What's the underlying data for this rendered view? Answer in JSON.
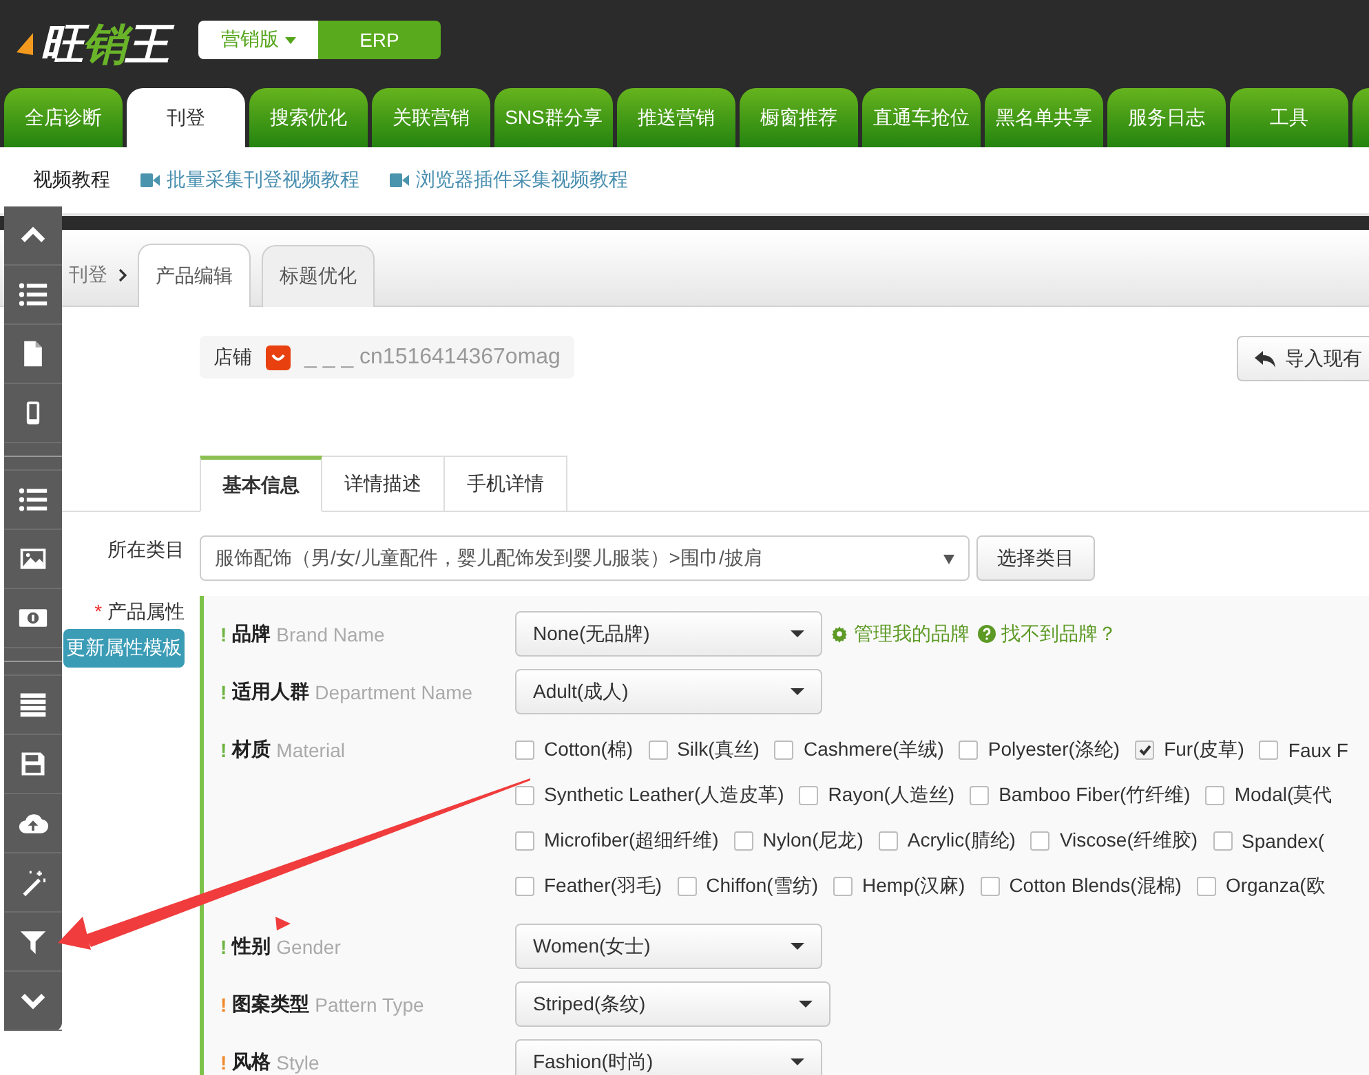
{
  "app": {
    "logo": "旺销王",
    "editions": [
      {
        "label": "营销版",
        "selected": true,
        "dropdown": true
      },
      {
        "label": "ERP",
        "selected": false,
        "dropdown": false
      }
    ]
  },
  "nav_tabs": [
    {
      "label": "全店诊断",
      "selected": false
    },
    {
      "label": "刊登",
      "selected": true
    },
    {
      "label": "搜索优化",
      "selected": false
    },
    {
      "label": "关联营销",
      "selected": false
    },
    {
      "label": "SNS群分享",
      "selected": false
    },
    {
      "label": "推送营销",
      "selected": false
    },
    {
      "label": "橱窗推荐",
      "selected": false
    },
    {
      "label": "直通车抢位",
      "selected": false
    },
    {
      "label": "黑名单共享",
      "selected": false
    },
    {
      "label": "服务日志",
      "selected": false
    },
    {
      "label": "工具",
      "selected": false
    }
  ],
  "tutorials": {
    "title": "视频教程",
    "links": [
      "批量采集刊登视频教程",
      "浏览器插件采集视频教程"
    ]
  },
  "breadcrumb": "刊登",
  "page_tabs": [
    {
      "label": "产品编辑",
      "selected": true
    },
    {
      "label": "标题优化",
      "selected": false
    }
  ],
  "store": {
    "label": "店铺",
    "name": "_ _ _ cn1516414367omag"
  },
  "import_button": "导入现有",
  "form_tabs": [
    {
      "label": "基本信息",
      "selected": true
    },
    {
      "label": "详情描述",
      "selected": false
    },
    {
      "label": "手机详情",
      "selected": false
    }
  ],
  "category": {
    "label": "所在类目",
    "value": "服饰配饰（男/女/儿童配件，婴儿配饰发到婴儿服装）>围巾/披肩",
    "button": "选择类目"
  },
  "attributes_label": {
    "mark": "*",
    "text": "产品属性"
  },
  "update_button": "更新属性模板",
  "attributes": [
    {
      "kind": "select",
      "flag": "!",
      "color": "#6db33f",
      "name": "品牌",
      "name_en": "Brand Name",
      "value": "None(无品牌)",
      "links": [
        "管理我的品牌",
        "找不到品牌？"
      ]
    },
    {
      "kind": "select",
      "flag": "!",
      "color": "#6db33f",
      "name": "适用人群",
      "name_en": "Department Name",
      "value": "Adult(成人)"
    },
    {
      "kind": "checkboxes",
      "flag": "!",
      "color": "#6db33f",
      "name": "材质",
      "name_en": "Material",
      "options": [
        [
          {
            "label": "Cotton(棉)",
            "checked": false
          },
          {
            "label": "Silk(真丝)",
            "checked": false
          },
          {
            "label": "Cashmere(羊绒)",
            "checked": false
          },
          {
            "label": "Polyester(涤纶)",
            "checked": false
          },
          {
            "label": "Fur(皮草)",
            "checked": true
          },
          {
            "label": "Faux F",
            "checked": false
          }
        ],
        [
          {
            "label": "Synthetic Leather(人造皮革)",
            "checked": false
          },
          {
            "label": "Rayon(人造丝)",
            "checked": false
          },
          {
            "label": "Bamboo Fiber(竹纤维)",
            "checked": false
          },
          {
            "label": "Modal(莫代",
            "checked": false
          }
        ],
        [
          {
            "label": "Microfiber(超细纤维)",
            "checked": false
          },
          {
            "label": "Nylon(尼龙)",
            "checked": false
          },
          {
            "label": "Acrylic(腈纶)",
            "checked": false
          },
          {
            "label": "Viscose(纤维胶)",
            "checked": false
          },
          {
            "label": "Spandex(",
            "checked": false
          }
        ],
        [
          {
            "label": "Feather(羽毛)",
            "checked": false
          },
          {
            "label": "Chiffon(雪纺)",
            "checked": false
          },
          {
            "label": "Hemp(汉麻)",
            "checked": false
          },
          {
            "label": "Cotton Blends(混棉)",
            "checked": false
          },
          {
            "label": "Organza(欧",
            "checked": false
          }
        ]
      ]
    },
    {
      "kind": "select",
      "flag": "!",
      "color": "#6db33f",
      "name": "性别",
      "name_en": "Gender",
      "value": "Women(女士)"
    },
    {
      "kind": "select",
      "flag": "!",
      "color": "#f0892a",
      "name": "图案类型",
      "name_en": "Pattern Type",
      "value": "Striped(条纹)"
    },
    {
      "kind": "select",
      "flag": "!",
      "color": "#f0892a",
      "name": "风格",
      "name_en": "Style",
      "value": "Fashion(时尚)"
    }
  ]
}
